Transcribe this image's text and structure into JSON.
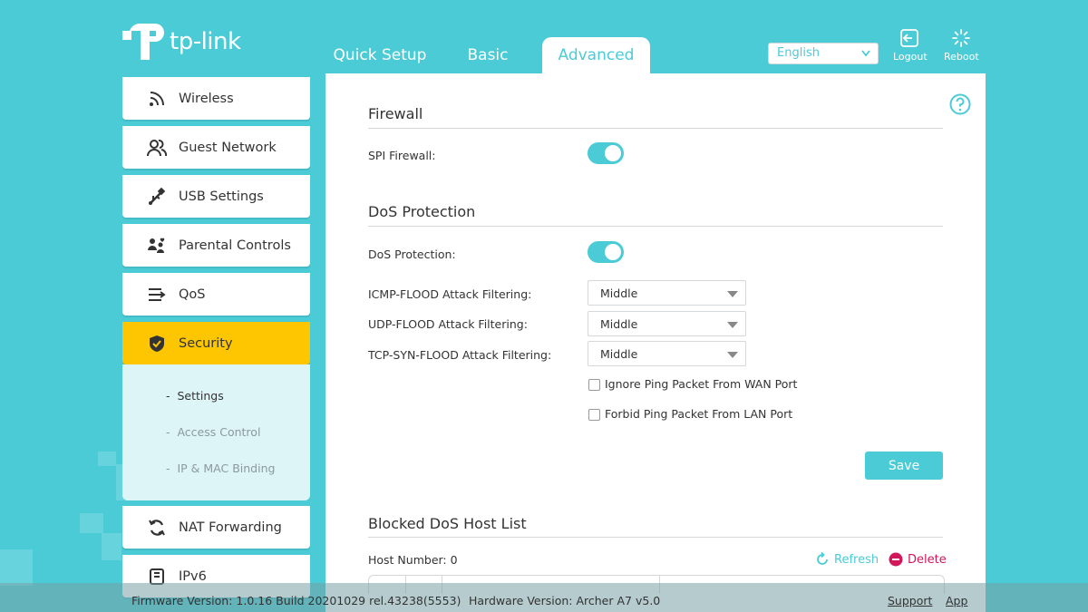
{
  "brand": {
    "name": "tp-link"
  },
  "nav": {
    "tabs": [
      "Quick Setup",
      "Basic",
      "Advanced"
    ],
    "active_tab": "Advanced"
  },
  "language": {
    "selected": "English"
  },
  "top_actions": {
    "logout": "Logout",
    "reboot": "Reboot"
  },
  "sidebar": {
    "items": [
      {
        "label": "Wireless",
        "icon": "wireless-icon"
      },
      {
        "label": "Guest Network",
        "icon": "guest-network-icon"
      },
      {
        "label": "USB Settings",
        "icon": "usb-icon"
      },
      {
        "label": "Parental Controls",
        "icon": "parental-controls-icon"
      },
      {
        "label": "QoS",
        "icon": "qos-icon"
      },
      {
        "label": "Security",
        "icon": "shield-icon",
        "active": true
      },
      {
        "label": "NAT Forwarding",
        "icon": "nat-icon"
      },
      {
        "label": "IPv6",
        "icon": "ipv6-icon"
      }
    ],
    "submenu": [
      {
        "label": "Settings",
        "active": true
      },
      {
        "label": "Access Control",
        "active": false
      },
      {
        "label": "IP & MAC Binding",
        "active": false
      }
    ],
    "submenu_prefix": "-"
  },
  "main": {
    "firewall": {
      "title": "Firewall",
      "spi_label": "SPI Firewall:",
      "spi_enabled": true
    },
    "dos": {
      "title": "DoS Protection",
      "toggle_label": "DoS Protection:",
      "enabled": true,
      "icmp_label": "ICMP-FLOOD Attack Filtering:",
      "icmp_value": "Middle",
      "udp_label": "UDP-FLOOD Attack Filtering:",
      "udp_value": "Middle",
      "tcp_label": "TCP-SYN-FLOOD Attack Filtering:",
      "tcp_value": "Middle",
      "ignore_ping_label": "Ignore Ping Packet From WAN Port",
      "ignore_ping_checked": false,
      "forbid_ping_label": "Forbid Ping Packet From LAN Port",
      "forbid_ping_checked": false,
      "save_label": "Save"
    },
    "blocked": {
      "title": "Blocked DoS Host List",
      "host_number": "Host Number: 0",
      "refresh_label": "Refresh",
      "delete_label": "Delete"
    }
  },
  "footer": {
    "firmware": "Firmware Version: 1.0.16 Build 20201029 rel.43238(5553)",
    "hardware": "Hardware Version: Archer A7 v5.0",
    "support": "Support",
    "app": "App"
  },
  "colors": {
    "accent": "#4acbd6",
    "active_item": "#fdc600",
    "delete": "#d0185a"
  }
}
